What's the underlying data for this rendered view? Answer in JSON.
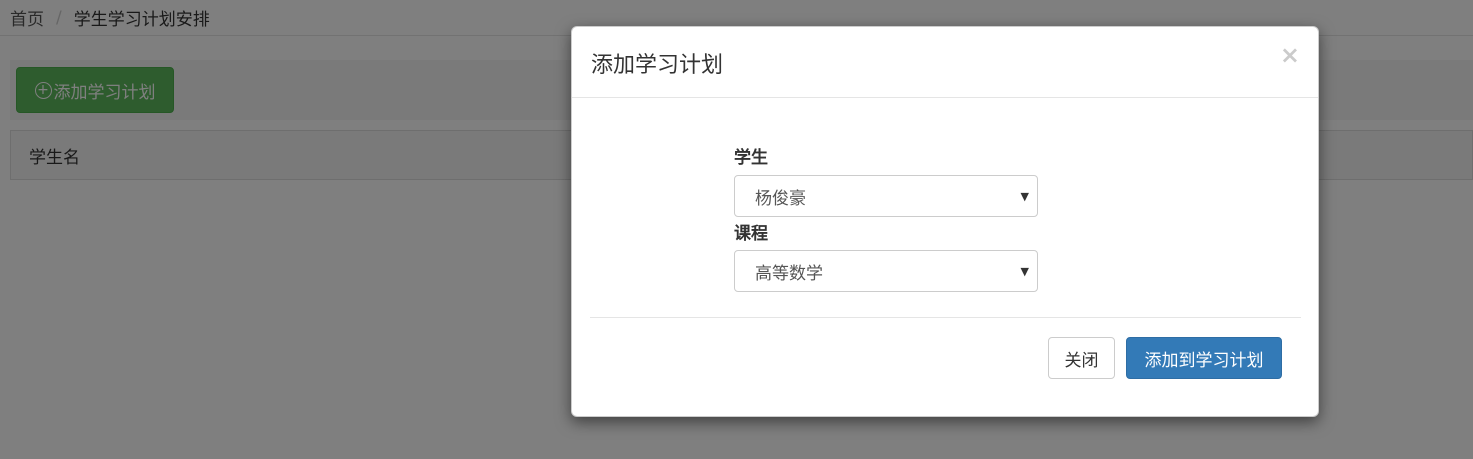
{
  "breadcrumb": {
    "home": "首页",
    "separator": "/",
    "current": "学生学习计划安排"
  },
  "toolbar": {
    "add_button_label": "添加学习计划",
    "add_button_icon": "plus-circle-icon"
  },
  "table": {
    "columns": [
      "学生名"
    ]
  },
  "modal": {
    "title": "添加学习计划",
    "close_symbol": "×",
    "student_label": "学生",
    "student_selected": "杨俊豪",
    "course_label": "课程",
    "course_selected": "高等数学",
    "close_button_label": "关闭",
    "submit_button_label": "添加到学习计划"
  },
  "colors": {
    "success": "#5cb85c",
    "primary": "#337ab7"
  }
}
